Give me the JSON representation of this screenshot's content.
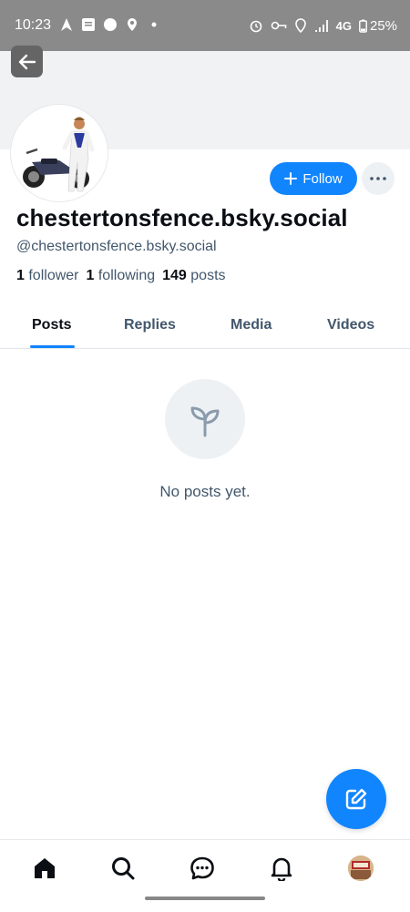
{
  "status_bar": {
    "time": "10:23",
    "network": "4G",
    "battery": "25%"
  },
  "profile": {
    "display_name": "chestertonsfence.bsky.social",
    "handle": "@chestertonsfence.bsky.social",
    "followers_count": "1",
    "followers_label": "follower",
    "following_count": "1",
    "following_label": "following",
    "posts_count": "149",
    "posts_label": "posts"
  },
  "actions": {
    "follow_label": "Follow"
  },
  "tabs": [
    {
      "label": "Posts",
      "active": true
    },
    {
      "label": "Replies",
      "active": false
    },
    {
      "label": "Media",
      "active": false
    },
    {
      "label": "Videos",
      "active": false
    }
  ],
  "empty_state": {
    "message": "No posts yet.",
    "icon": "sprout-icon"
  },
  "bottom_nav": {
    "items": [
      "home-icon",
      "search-icon",
      "chat-icon",
      "bell-icon",
      "profile-avatar"
    ]
  },
  "colors": {
    "accent": "#1185fe",
    "muted_text": "#42576c"
  }
}
